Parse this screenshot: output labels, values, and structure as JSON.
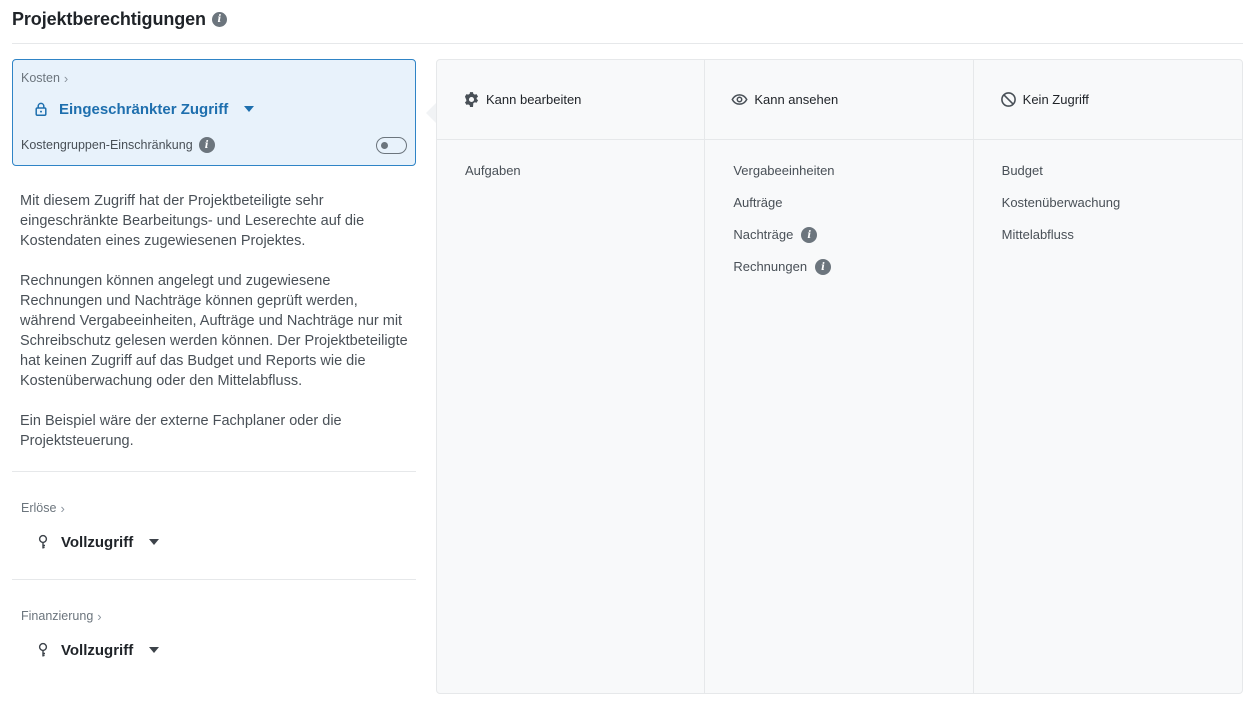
{
  "page": {
    "title": "Projektberechtigungen"
  },
  "selected_module": {
    "breadcrumb": "Kosten",
    "access_label": "Eingeschränkter Zugriff",
    "restriction_label": "Kostengruppen-Einschränkung",
    "restriction_enabled": false
  },
  "description": {
    "paragraphs": [
      "Mit diesem Zugriff hat der Projektbeteiligte sehr eingeschränkte Bearbeitungs- und Leserechte auf die Kostendaten eines zugewiesenen Projektes.",
      "Rechnungen können angelegt und zugewiesene Rechnungen und Nachträge können geprüft werden, während Vergabeeinheiten, Aufträge und Nachträge nur mit Schreibschutz gelesen werden können. Der Projektbeteiligte hat keinen Zugriff auf das Budget und Reports wie die Kostenüberwachung oder den Mittelabfluss.",
      "Ein Beispiel wäre der externe Fachplaner oder die Projektsteuerung."
    ]
  },
  "modules": [
    {
      "breadcrumb": "Erlöse",
      "access_label": "Vollzugriff"
    },
    {
      "breadcrumb": "Finanzierung",
      "access_label": "Vollzugriff"
    }
  ],
  "permissions": {
    "edit": {
      "header": "Kann bearbeiten",
      "icon": "gear-icon",
      "items": [
        "Aufgaben"
      ]
    },
    "view": {
      "header": "Kann ansehen",
      "icon": "eye-icon",
      "items": [
        "Vergabeeinheiten",
        "Aufträge",
        "Nachträge",
        "Rechnungen"
      ],
      "info_items": [
        2,
        3
      ]
    },
    "none": {
      "header": "Kein Zugriff",
      "icon": "prohibited-icon",
      "items": [
        "Budget",
        "Kostenüberwachung",
        "Mittelabfluss"
      ]
    }
  },
  "colors": {
    "accent": "#1e6fae",
    "accent_border": "#2f84c6",
    "accent_bg": "#e8f2fb",
    "panel_bg": "#f8f9fa"
  }
}
